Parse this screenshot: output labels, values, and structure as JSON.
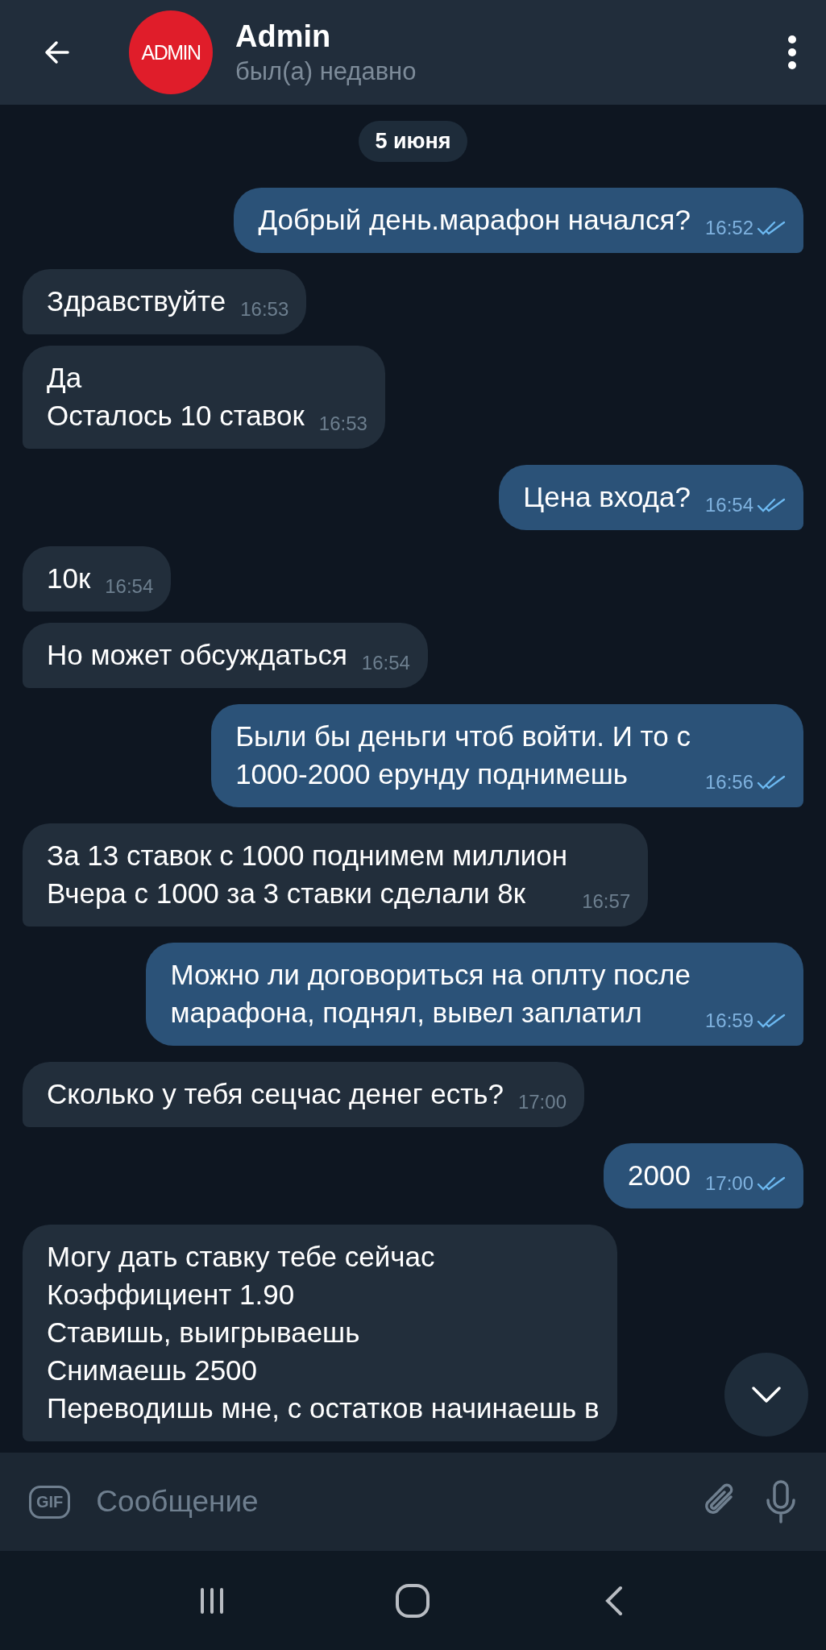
{
  "header": {
    "title": "Admin",
    "status": "был(а) недавно",
    "avatar_text": "ADMIN"
  },
  "date_chip": "5 июня",
  "messages": [
    {
      "kind": "out",
      "lines": [
        "Добрый день.марафон начался?"
      ],
      "time": "16:52",
      "read": true
    },
    {
      "kind": "in",
      "lines": [
        "Здравствуйте"
      ],
      "time": "16:53"
    },
    {
      "kind": "in",
      "lines": [
        "Да",
        "Осталось 10 ставок"
      ],
      "time": "16:53"
    },
    {
      "kind": "out",
      "lines": [
        "Цена входа?"
      ],
      "time": "16:54",
      "read": true
    },
    {
      "kind": "in",
      "lines": [
        "10к"
      ],
      "time": "16:54"
    },
    {
      "kind": "in",
      "lines": [
        "Но может обсуждаться"
      ],
      "time": "16:54"
    },
    {
      "kind": "out",
      "lines": [
        "Были бы деньги чтоб войти. И то с",
        "1000-2000 ерунду поднимешь"
      ],
      "time": "16:56",
      "read": true
    },
    {
      "kind": "in",
      "lines": [
        "За 13 ставок с 1000 поднимем миллион",
        "Вчера с 1000 за 3 ставки сделали 8к"
      ],
      "time": "16:57"
    },
    {
      "kind": "out",
      "lines": [
        "Можно ли договориться на оплту после",
        "марафона, поднял, вывел заплатил"
      ],
      "time": "16:59",
      "read": true
    },
    {
      "kind": "in",
      "lines": [
        "Сколько у тебя сецчас денег есть?"
      ],
      "time": "17:00"
    },
    {
      "kind": "out",
      "lines": [
        "2000"
      ],
      "time": "17:00",
      "read": true
    },
    {
      "kind": "in",
      "lines": [
        "Могу дать ставку тебе сейчас",
        "Коэффициент 1.90",
        "Ставишь, выигрываешь",
        "Снимаешь 2500",
        "Переводишь мне, с остатков начинаешь в"
      ]
    }
  ],
  "composer": {
    "placeholder": "Сообщение",
    "gif_label": "GIF"
  }
}
